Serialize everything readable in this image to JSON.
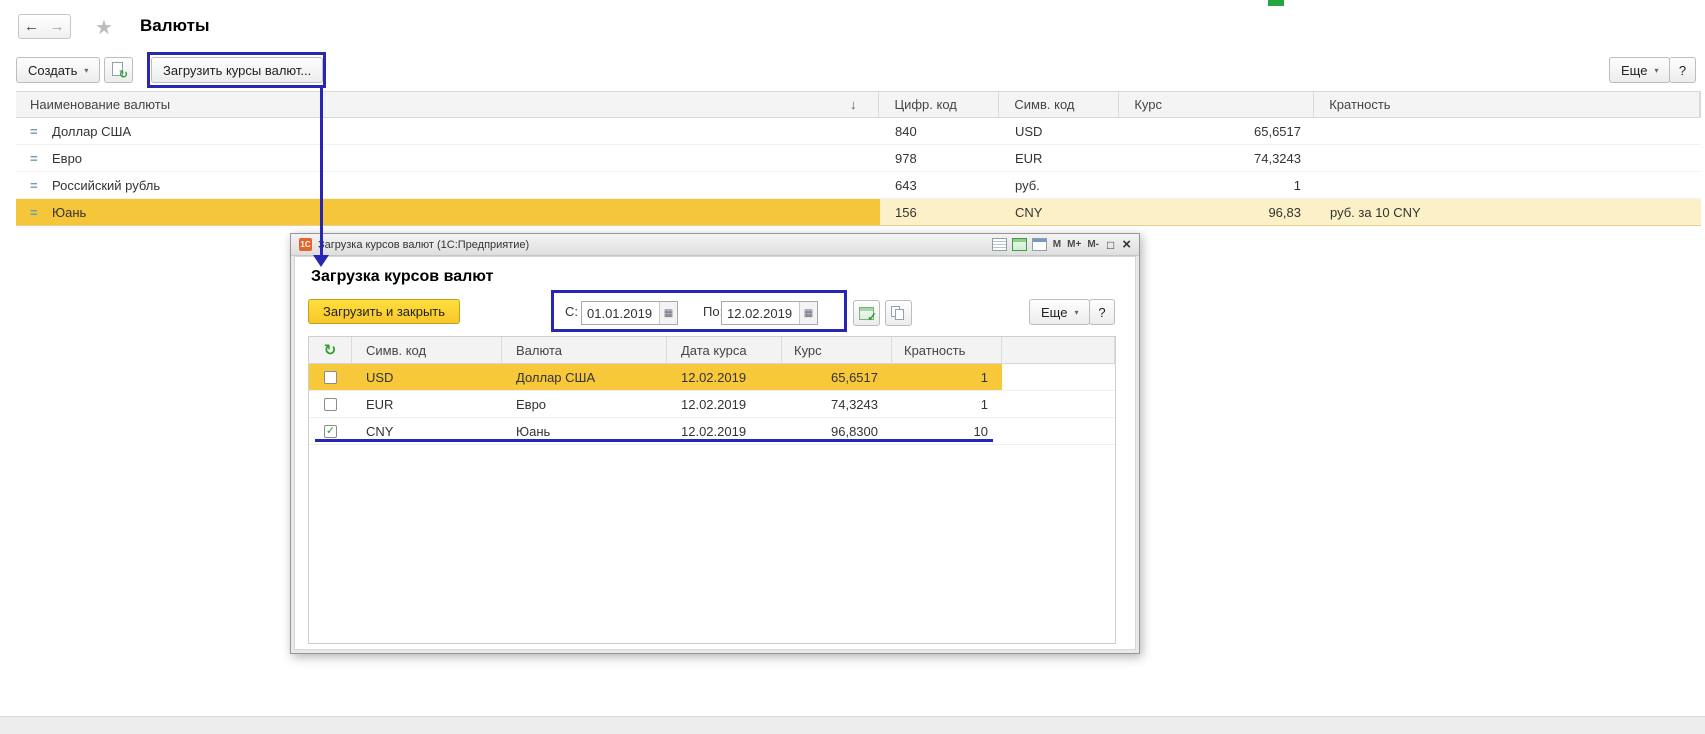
{
  "icons": {
    "back": "←",
    "forward": "→",
    "star": "★",
    "dropdown": "▾",
    "sort_desc": "↓",
    "row_marker": "=",
    "refresh": "↻",
    "check": "✓",
    "calendar_dots": "▦",
    "maximize": "□",
    "close": "×"
  },
  "header": {
    "title": "Валюты"
  },
  "toolbar": {
    "create": "Создать",
    "load_rates": "Загрузить курсы валют...",
    "more": "Еще",
    "help": "?"
  },
  "currency_table": {
    "columns": {
      "name": "Наименование валюты",
      "num_code": "Цифр. код",
      "sym_code": "Симв. код",
      "rate": "Курс",
      "multiplicity": "Кратность"
    },
    "rows": [
      {
        "name": "Доллар США",
        "num_code": "840",
        "sym_code": "USD",
        "rate": "65,6517",
        "multiplicity": ""
      },
      {
        "name": "Евро",
        "num_code": "978",
        "sym_code": "EUR",
        "rate": "74,3243",
        "multiplicity": ""
      },
      {
        "name": "Российский рубль",
        "num_code": "643",
        "sym_code": "руб.",
        "rate": "1",
        "multiplicity": ""
      },
      {
        "name": "Юань",
        "num_code": "156",
        "sym_code": "CNY",
        "rate": "96,83",
        "multiplicity": "руб. за 10 CNY"
      }
    ]
  },
  "dialog": {
    "titlebar": {
      "app_badge": "1С",
      "title": "Загрузка курсов валют  (1С:Предприятие)",
      "mem_buttons": [
        "M",
        "M+",
        "M-"
      ]
    },
    "heading": "Загрузка курсов валют",
    "load_and_close": "Загрузить и закрыть",
    "date_from_label": "С:",
    "date_from": "01.01.2019",
    "date_to_label": "По:",
    "date_to": "12.02.2019",
    "more": "Еще",
    "help": "?",
    "rates_table": {
      "columns": {
        "sym_code": "Симв. код",
        "currency": "Валюта",
        "date": "Дата курса",
        "rate": "Курс",
        "multiplicity": "Кратность"
      },
      "rows": [
        {
          "check": "",
          "sym_code": "USD",
          "currency": "Доллар США",
          "date": "12.02.2019",
          "rate": "65,6517",
          "multiplicity": "1"
        },
        {
          "check": "",
          "sym_code": "EUR",
          "currency": "Евро",
          "date": "12.02.2019",
          "rate": "74,3243",
          "multiplicity": "1"
        },
        {
          "check": "✓",
          "sym_code": "CNY",
          "currency": "Юань",
          "date": "12.02.2019",
          "rate": "96,8300",
          "multiplicity": "10"
        }
      ]
    }
  }
}
